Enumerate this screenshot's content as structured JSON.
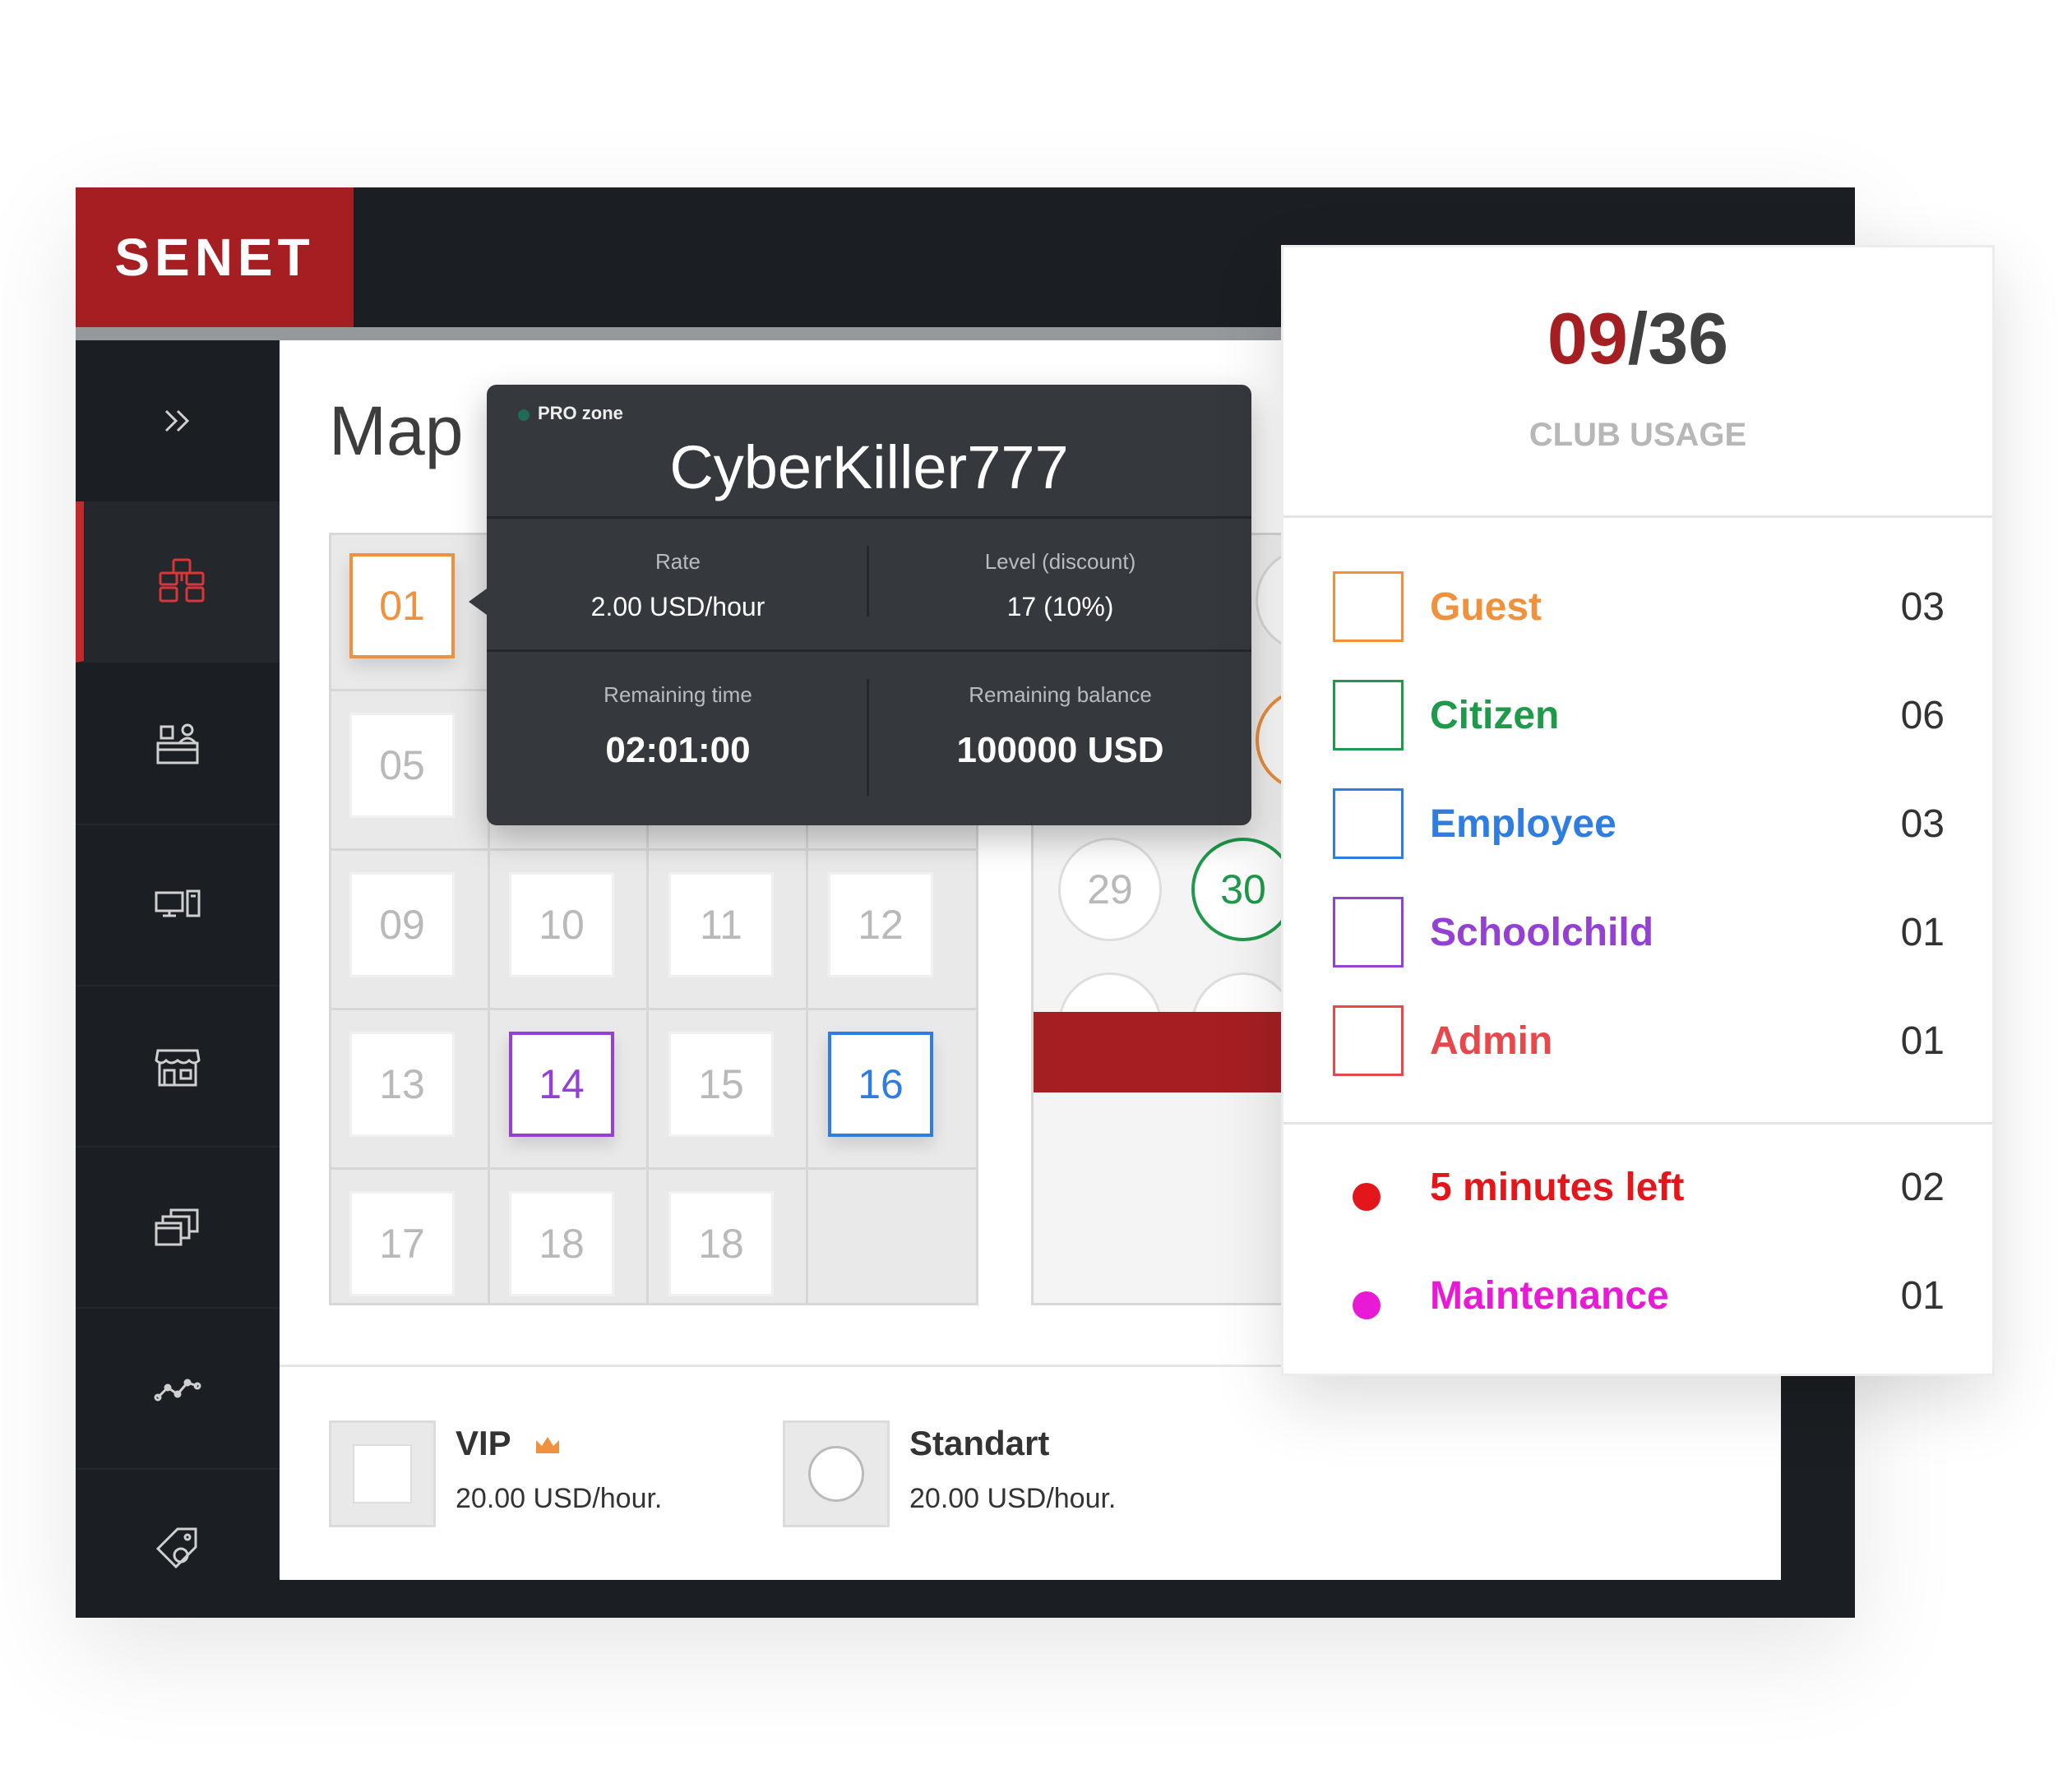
{
  "app": {
    "logo": "SENET"
  },
  "sidebar": {
    "items": [
      {
        "icon": "double-chevron-right-icon"
      },
      {
        "icon": "map-network-icon",
        "active": true
      },
      {
        "icon": "users-desk-icon"
      },
      {
        "icon": "computers-icon"
      },
      {
        "icon": "store-icon"
      },
      {
        "icon": "windows-stack-icon"
      },
      {
        "icon": "analytics-line-icon"
      },
      {
        "icon": "tag-settings-icon"
      }
    ]
  },
  "page": {
    "title": "Map"
  },
  "grid": {
    "seats": [
      {
        "label": "01",
        "type": "guest"
      },
      {
        "label": "05",
        "type": "free"
      },
      {
        "label": "09",
        "type": "free"
      },
      {
        "label": "10",
        "type": "free"
      },
      {
        "label": "11",
        "type": "free"
      },
      {
        "label": "12",
        "type": "free"
      },
      {
        "label": "13",
        "type": "free"
      },
      {
        "label": "14",
        "type": "schoolchild"
      },
      {
        "label": "15",
        "type": "free"
      },
      {
        "label": "16",
        "type": "employee"
      },
      {
        "label": "17",
        "type": "free"
      },
      {
        "label": "18",
        "type": "free"
      },
      {
        "label": "18",
        "type": "free"
      }
    ]
  },
  "round_seats": [
    {
      "label": "29",
      "type": "free"
    },
    {
      "label": "30",
      "type": "citizen"
    }
  ],
  "tooltip": {
    "zone": "PRO zone",
    "username": "CyberKiller777",
    "rate_label": "Rate",
    "rate_value": "2.00 USD/hour",
    "level_label": "Level (discount)",
    "level_value": "17 (10%)",
    "time_label": "Remaining time",
    "time_value": "02:01:00",
    "balance_label": "Remaining balance",
    "balance_value": "100000 USD"
  },
  "zones": [
    {
      "name": "VIP",
      "price": "20.00 USD/hour.",
      "icon": "crown-icon"
    },
    {
      "name": "Standart",
      "price": "20.00 USD/hour."
    }
  ],
  "usage": {
    "used": "09",
    "separator": "/",
    "total": "36",
    "label": "CLUB USAGE"
  },
  "legend": [
    {
      "label": "Guest",
      "count": "03",
      "color": "#f0913e"
    },
    {
      "label": "Citizen",
      "count": "06",
      "color": "#1f9a4b"
    },
    {
      "label": "Employee",
      "count": "03",
      "color": "#2f7de1"
    },
    {
      "label": "Schoolchild",
      "count": "01",
      "color": "#9340d3"
    },
    {
      "label": "Admin",
      "count": "01",
      "color": "#e8474b"
    }
  ],
  "statuses": [
    {
      "label": "5 minutes left",
      "count": "02",
      "color": "#e3161b"
    },
    {
      "label": "Maintenance",
      "count": "01",
      "color": "#e91ad6"
    }
  ]
}
